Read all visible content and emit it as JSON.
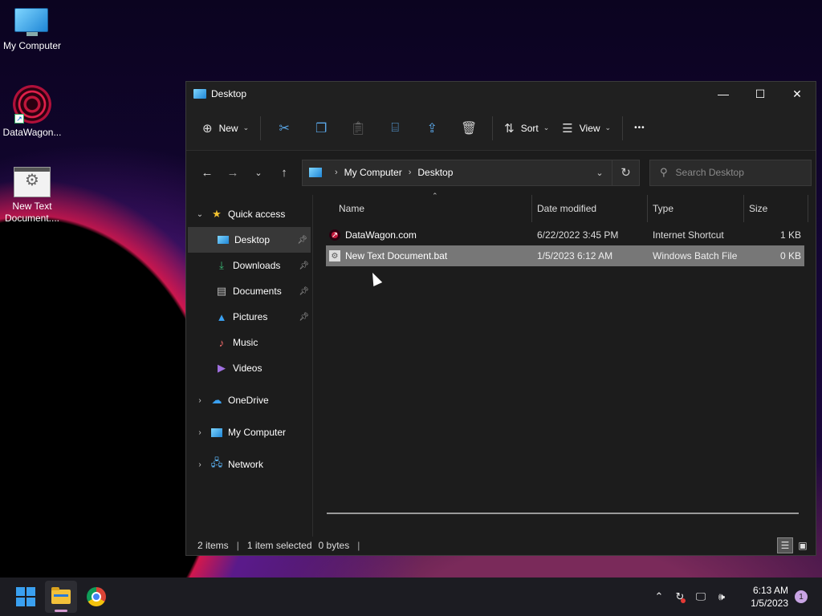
{
  "desktop": {
    "icons": [
      {
        "label": "My Computer",
        "icon": "monitor-icon"
      },
      {
        "label": "DataWagon...",
        "icon": "datawagon-icon"
      },
      {
        "label": "New Text Document....",
        "icon": "batch-file-icon"
      }
    ]
  },
  "window": {
    "title": "Desktop",
    "controls": {
      "minimize": "—",
      "maximize": "☐",
      "close": "✕"
    }
  },
  "toolbar": {
    "new_label": "New",
    "sort_label": "Sort",
    "view_label": "View",
    "more_label": "•••"
  },
  "address": {
    "crumbs": [
      "My Computer",
      "Desktop"
    ],
    "search_placeholder": "Search Desktop"
  },
  "sidebar": {
    "quick_access_label": "Quick access",
    "items": [
      {
        "label": "Desktop",
        "pinned": true,
        "selected": true
      },
      {
        "label": "Downloads",
        "pinned": true
      },
      {
        "label": "Documents",
        "pinned": true
      },
      {
        "label": "Pictures",
        "pinned": true
      },
      {
        "label": "Music"
      },
      {
        "label": "Videos"
      }
    ],
    "roots": [
      {
        "label": "OneDrive"
      },
      {
        "label": "My Computer"
      },
      {
        "label": "Network"
      }
    ]
  },
  "columns": {
    "name": "Name",
    "date": "Date modified",
    "type": "Type",
    "size": "Size"
  },
  "files": [
    {
      "name": "DataWagon.com",
      "date": "6/22/2022 3:45 PM",
      "type": "Internet Shortcut",
      "size": "1 KB",
      "selected": false
    },
    {
      "name": "New Text Document.bat",
      "date": "1/5/2023 6:12 AM",
      "type": "Windows Batch File",
      "size": "0 KB",
      "selected": true
    }
  ],
  "status": {
    "items": "2 items",
    "selected": "1 item selected",
    "bytes": "0 bytes"
  },
  "taskbar": {
    "time": "6:13 AM",
    "date": "1/5/2023",
    "notifications": "1"
  },
  "colors": {
    "window_bg": "#1c1c1c",
    "selected_row": "#777777",
    "accent": "#5aa7e8"
  }
}
